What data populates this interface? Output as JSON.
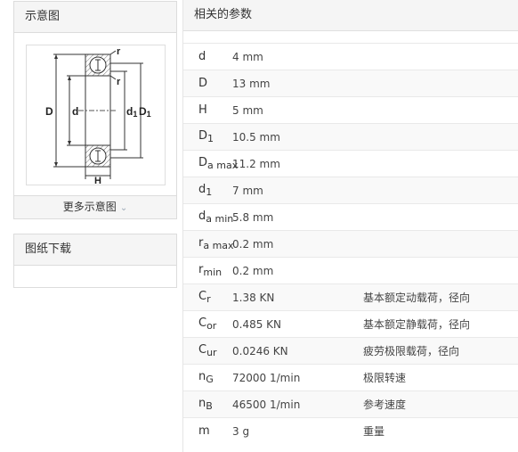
{
  "diagram_panel": {
    "title": "示意图",
    "more_link": "更多示意图",
    "labels": {
      "d": "d",
      "D": "D",
      "d1": "d",
      "d1_sub": "1",
      "D1": "D",
      "D1_sub": "1",
      "r_top": "r",
      "r_inner": "r",
      "H": "H"
    }
  },
  "download_panel": {
    "title": "图纸下载"
  },
  "params": {
    "title": "相关的参数",
    "rows": [
      {
        "sym": "d",
        "sub": "",
        "value": "4 mm",
        "desc": ""
      },
      {
        "sym": "D",
        "sub": "",
        "value": "13 mm",
        "desc": ""
      },
      {
        "sym": "H",
        "sub": "",
        "value": "5 mm",
        "desc": ""
      },
      {
        "sym": "D",
        "sub": "1",
        "value": "10.5 mm",
        "desc": ""
      },
      {
        "sym": "D",
        "sub": "a max",
        "value": "11.2 mm",
        "desc": ""
      },
      {
        "sym": "d",
        "sub": "1",
        "value": "7 mm",
        "desc": ""
      },
      {
        "sym": "d",
        "sub": "a min",
        "value": "5.8 mm",
        "desc": ""
      },
      {
        "sym": "r",
        "sub": "a max",
        "value": "0.2 mm",
        "desc": ""
      },
      {
        "sym": "r",
        "sub": "min",
        "value": "0.2 mm",
        "desc": ""
      },
      {
        "sym": "C",
        "sub": "r",
        "value": "1.38 KN",
        "desc": "基本额定动载荷，径向"
      },
      {
        "sym": "C",
        "sub": "or",
        "value": "0.485 KN",
        "desc": "基本额定静载荷，径向"
      },
      {
        "sym": "C",
        "sub": "ur",
        "value": "0.0246 KN",
        "desc": "疲劳极限载荷，径向"
      },
      {
        "sym": "n",
        "sub": "G",
        "value": "72000 1/min",
        "desc": "极限转速"
      },
      {
        "sym": "n",
        "sub": "B",
        "value": "46500 1/min",
        "desc": "参考速度"
      },
      {
        "sym": "m",
        "sub": "",
        "value": "3 g",
        "desc": "重量"
      }
    ]
  }
}
